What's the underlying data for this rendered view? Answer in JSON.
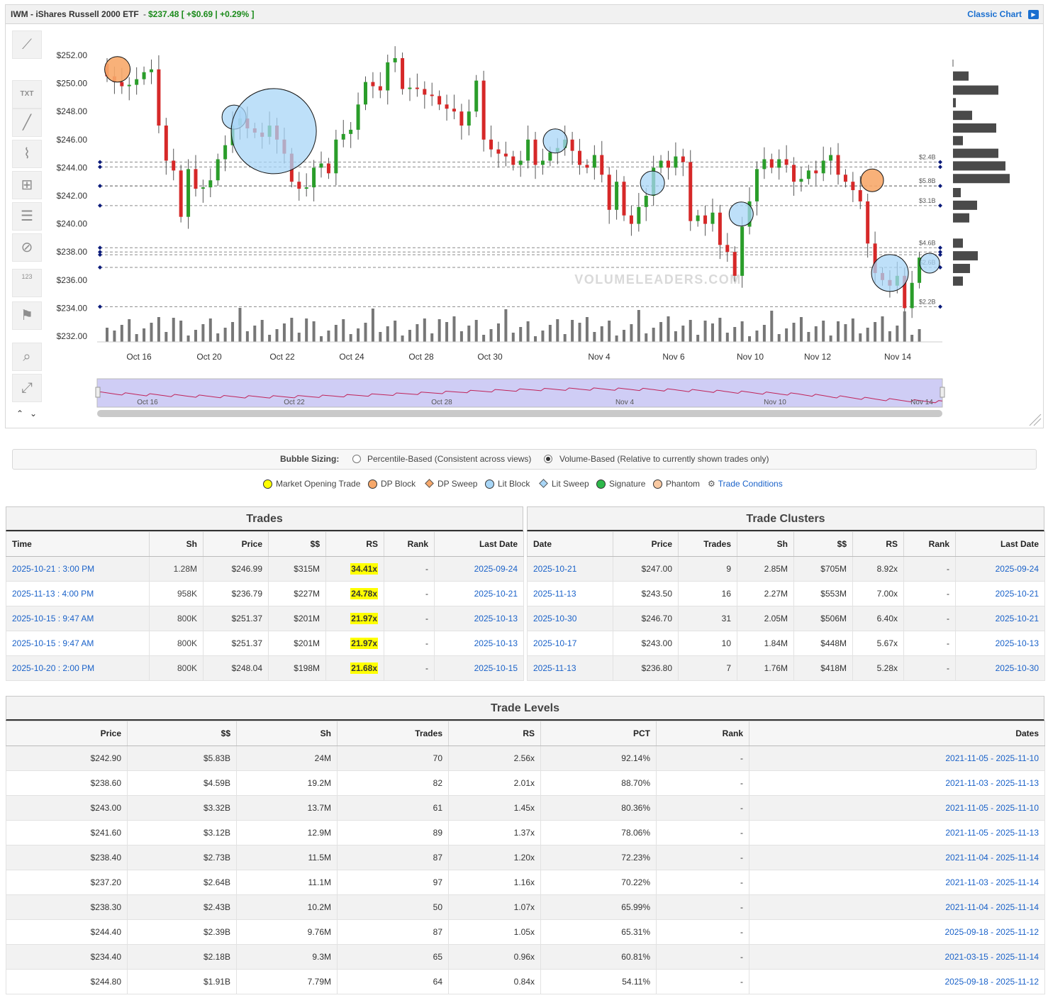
{
  "header": {
    "ticker": "IWM - iShares Russell 2000 ETF",
    "dash": "-",
    "quote": "$237.48 [ +$0.69 | +0.29% ]",
    "classic_chart": "Classic Chart",
    "quote_color": "#1a8a1a",
    "link_color": "#1a6fd0"
  },
  "toolbar": {
    "icons": [
      "trend-lines-icon",
      "text-icon",
      "line-icon",
      "fibonacci-icon",
      "crosshair-box-icon",
      "grid-lines-icon",
      "hide-icon",
      "measure-icon",
      "flag-icon",
      "zoom-icon",
      "fullscreen-icon",
      "chevron-up-icon",
      "chevron-down-icon"
    ],
    "text_icon": "TXT",
    "measure_icon_text": "123"
  },
  "chart_data": {
    "type": "candlestick",
    "title": "",
    "y_ticks": [
      "$252.00",
      "$250.00",
      "$248.00",
      "$246.00",
      "$244.00",
      "$242.00",
      "$240.00",
      "$238.00",
      "$236.00",
      "$234.00",
      "$232.00"
    ],
    "x_ticks": [
      "Oct 16",
      "Oct 20",
      "Oct 22",
      "Oct 24",
      "Oct 28",
      "Oct 30",
      "Nov 4",
      "Nov 6",
      "Nov 10",
      "Nov 12",
      "Nov 14"
    ],
    "ylim": [
      232,
      252.8
    ],
    "watermark": "VOLUMELEADERS.COM",
    "navigator_ticks": [
      "Oct 16",
      "Oct 22",
      "Oct 28",
      "Nov 4",
      "Nov 10",
      "Nov 14"
    ],
    "levels": [
      {
        "price": 244.4,
        "label": "$2.4B"
      },
      {
        "price": 244.05,
        "label": ""
      },
      {
        "price": 242.7,
        "label": "$5.8B"
      },
      {
        "price": 241.3,
        "label": "$3.1B"
      },
      {
        "price": 238.3,
        "label": "$4.6B"
      },
      {
        "price": 238.0,
        "label": ""
      },
      {
        "price": 237.8,
        "label": ""
      },
      {
        "price": 236.9,
        "label": "$2.6B"
      },
      {
        "price": 234.1,
        "label": "$2.2B"
      }
    ],
    "bubbles": [
      {
        "type": "DP Block",
        "x_pct": 0.024,
        "price": 251.0,
        "r": 18
      },
      {
        "type": "Lit Block",
        "x_pct": 0.162,
        "price": 247.6,
        "r": 17
      },
      {
        "type": "Lit Block",
        "x_pct": 0.209,
        "price": 246.6,
        "r": 60
      },
      {
        "type": "Lit Block",
        "x_pct": 0.542,
        "price": 245.9,
        "r": 17
      },
      {
        "type": "Lit Block",
        "x_pct": 0.657,
        "price": 242.9,
        "r": 17
      },
      {
        "type": "Lit Block",
        "x_pct": 0.762,
        "price": 240.7,
        "r": 17
      },
      {
        "type": "DP Block",
        "x_pct": 0.917,
        "price": 243.1,
        "r": 16
      },
      {
        "type": "Lit Block",
        "x_pct": 0.938,
        "price": 236.5,
        "r": 26
      },
      {
        "type": "Lit Block",
        "x_pct": 0.985,
        "price": 237.2,
        "r": 14
      }
    ],
    "profile": [
      {
        "price": 250.5,
        "w": 22
      },
      {
        "price": 249.5,
        "w": 64
      },
      {
        "price": 248.6,
        "w": 4
      },
      {
        "price": 247.7,
        "w": 27
      },
      {
        "price": 246.8,
        "w": 61
      },
      {
        "price": 245.9,
        "w": 14
      },
      {
        "price": 245.0,
        "w": 64
      },
      {
        "price": 244.1,
        "w": 74
      },
      {
        "price": 243.2,
        "w": 80
      },
      {
        "price": 242.2,
        "w": 11
      },
      {
        "price": 241.3,
        "w": 34
      },
      {
        "price": 240.4,
        "w": 23
      },
      {
        "price": 238.6,
        "w": 14
      },
      {
        "price": 237.7,
        "w": 35
      },
      {
        "price": 236.8,
        "w": 24
      },
      {
        "price": 235.9,
        "w": 14
      }
    ]
  },
  "bubble_sizing": {
    "label": "Bubble Sizing:",
    "options": [
      "Percentile-Based (Consistent across views)",
      "Volume-Based (Relative to currently shown trades only)"
    ],
    "selected": 1
  },
  "legend": [
    {
      "label": "Market Opening Trade",
      "shape": "circle",
      "color": "#ffff00"
    },
    {
      "label": "DP Block",
      "shape": "circle",
      "color": "#f7a86a"
    },
    {
      "label": "DP Sweep",
      "shape": "diamond",
      "color": "#f7a86a"
    },
    {
      "label": "Lit Block",
      "shape": "circle",
      "color": "#a8d6f7"
    },
    {
      "label": "Lit Sweep",
      "shape": "diamond",
      "color": "#a8d6f7"
    },
    {
      "label": "Signature",
      "shape": "circle",
      "color": "#2db84a"
    },
    {
      "label": "Phantom",
      "shape": "circle",
      "color": "#f9c9a2"
    },
    {
      "label": "Trade Conditions",
      "shape": "icon",
      "color": "#1a62c9"
    }
  ],
  "trades": {
    "title": "Trades",
    "columns": [
      "Time",
      "Sh",
      "Price",
      "$$",
      "RS",
      "Rank",
      "Last Date"
    ],
    "rows": [
      [
        "2025-10-21 : 3:00 PM",
        "1.28M",
        "$246.99",
        "$315M",
        "34.41x",
        "-",
        "2025-09-24"
      ],
      [
        "2025-11-13 : 4:00 PM",
        "958K",
        "$236.79",
        "$227M",
        "24.78x",
        "-",
        "2025-10-21"
      ],
      [
        "2025-10-15 : 9:47 AM",
        "800K",
        "$251.37",
        "$201M",
        "21.97x",
        "-",
        "2025-10-13"
      ],
      [
        "2025-10-15 : 9:47 AM",
        "800K",
        "$251.37",
        "$201M",
        "21.97x",
        "-",
        "2025-10-13"
      ],
      [
        "2025-10-20 : 2:00 PM",
        "800K",
        "$248.04",
        "$198M",
        "21.68x",
        "-",
        "2025-10-15"
      ]
    ]
  },
  "clusters": {
    "title": "Trade Clusters",
    "columns": [
      "Date",
      "Price",
      "Trades",
      "Sh",
      "$$",
      "RS",
      "Rank",
      "Last Date"
    ],
    "rows": [
      [
        "2025-10-21",
        "$247.00",
        "9",
        "2.85M",
        "$705M",
        "8.92x",
        "-",
        "2025-09-24"
      ],
      [
        "2025-11-13",
        "$243.50",
        "16",
        "2.27M",
        "$553M",
        "7.00x",
        "-",
        "2025-10-21"
      ],
      [
        "2025-10-30",
        "$246.70",
        "31",
        "2.05M",
        "$506M",
        "6.40x",
        "-",
        "2025-10-21"
      ],
      [
        "2025-10-17",
        "$243.00",
        "10",
        "1.84M",
        "$448M",
        "5.67x",
        "-",
        "2025-10-13"
      ],
      [
        "2025-11-13",
        "$236.80",
        "7",
        "1.76M",
        "$418M",
        "5.28x",
        "-",
        "2025-10-30"
      ]
    ]
  },
  "levels": {
    "title": "Trade Levels",
    "columns": [
      "Price",
      "$$",
      "Sh",
      "Trades",
      "RS",
      "PCT",
      "Rank",
      "Dates"
    ],
    "rows": [
      [
        "$242.90",
        "$5.83B",
        "24M",
        "70",
        "2.56x",
        "92.14%",
        "-",
        "2021-11-05 - 2025-11-10"
      ],
      [
        "$238.60",
        "$4.59B",
        "19.2M",
        "82",
        "2.01x",
        "88.70%",
        "-",
        "2021-11-03 - 2025-11-13"
      ],
      [
        "$243.00",
        "$3.32B",
        "13.7M",
        "61",
        "1.45x",
        "80.36%",
        "-",
        "2021-11-05 - 2025-11-10"
      ],
      [
        "$241.60",
        "$3.12B",
        "12.9M",
        "89",
        "1.37x",
        "78.06%",
        "-",
        "2021-11-05 - 2025-11-13"
      ],
      [
        "$238.40",
        "$2.73B",
        "11.5M",
        "87",
        "1.20x",
        "72.23%",
        "-",
        "2021-11-04 - 2025-11-14"
      ],
      [
        "$237.20",
        "$2.64B",
        "11.1M",
        "97",
        "1.16x",
        "70.22%",
        "-",
        "2021-11-03 - 2025-11-14"
      ],
      [
        "$238.30",
        "$2.43B",
        "10.2M",
        "50",
        "1.07x",
        "65.99%",
        "-",
        "2021-11-04 - 2025-11-14"
      ],
      [
        "$244.40",
        "$2.39B",
        "9.76M",
        "87",
        "1.05x",
        "65.31%",
        "-",
        "2025-09-18 - 2025-11-12"
      ],
      [
        "$234.40",
        "$2.18B",
        "9.3M",
        "65",
        "0.96x",
        "60.81%",
        "-",
        "2021-03-15 - 2025-11-14"
      ],
      [
        "$244.80",
        "$1.91B",
        "7.79M",
        "64",
        "0.84x",
        "54.11%",
        "-",
        "2025-09-18 - 2025-11-12"
      ]
    ]
  }
}
